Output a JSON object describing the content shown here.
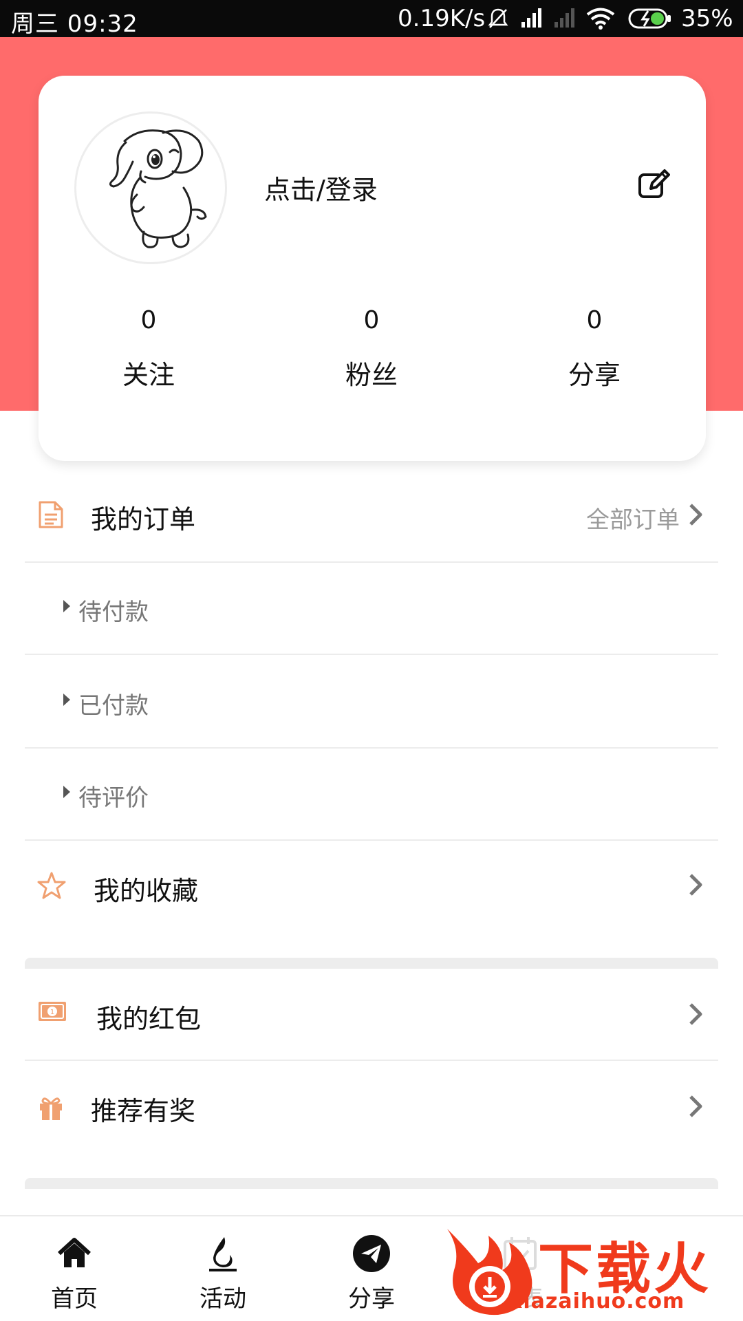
{
  "status_bar": {
    "day_time": "周三  09:32",
    "net_speed": "0.19K/s",
    "battery_percent": "35%"
  },
  "profile": {
    "login_prompt": "点击/登录",
    "stats": [
      {
        "value": "0",
        "label": "关注"
      },
      {
        "value": "0",
        "label": "粉丝"
      },
      {
        "value": "0",
        "label": "分享"
      }
    ]
  },
  "orders": {
    "title": "我的订单",
    "view_all": "全部订单",
    "sub_items": [
      {
        "label": "待付款"
      },
      {
        "label": "已付款"
      },
      {
        "label": "待评价"
      }
    ]
  },
  "menu": {
    "favorites": "我的收藏",
    "red_packets": "我的红包",
    "referral": "推荐有奖"
  },
  "bottom_nav": {
    "items": [
      {
        "label": "首页",
        "icon": "home-icon"
      },
      {
        "label": "活动",
        "icon": "flame-icon"
      },
      {
        "label": "分享",
        "icon": "send-icon"
      },
      {
        "label": "报表",
        "icon": "calendar-icon"
      }
    ]
  },
  "watermark": {
    "brand": "下载火",
    "url": "xiazaihuo.com"
  },
  "colors": {
    "header": "#ff6b6b",
    "accent_icon": "#f0a070",
    "watermark": "#f03a1c"
  }
}
